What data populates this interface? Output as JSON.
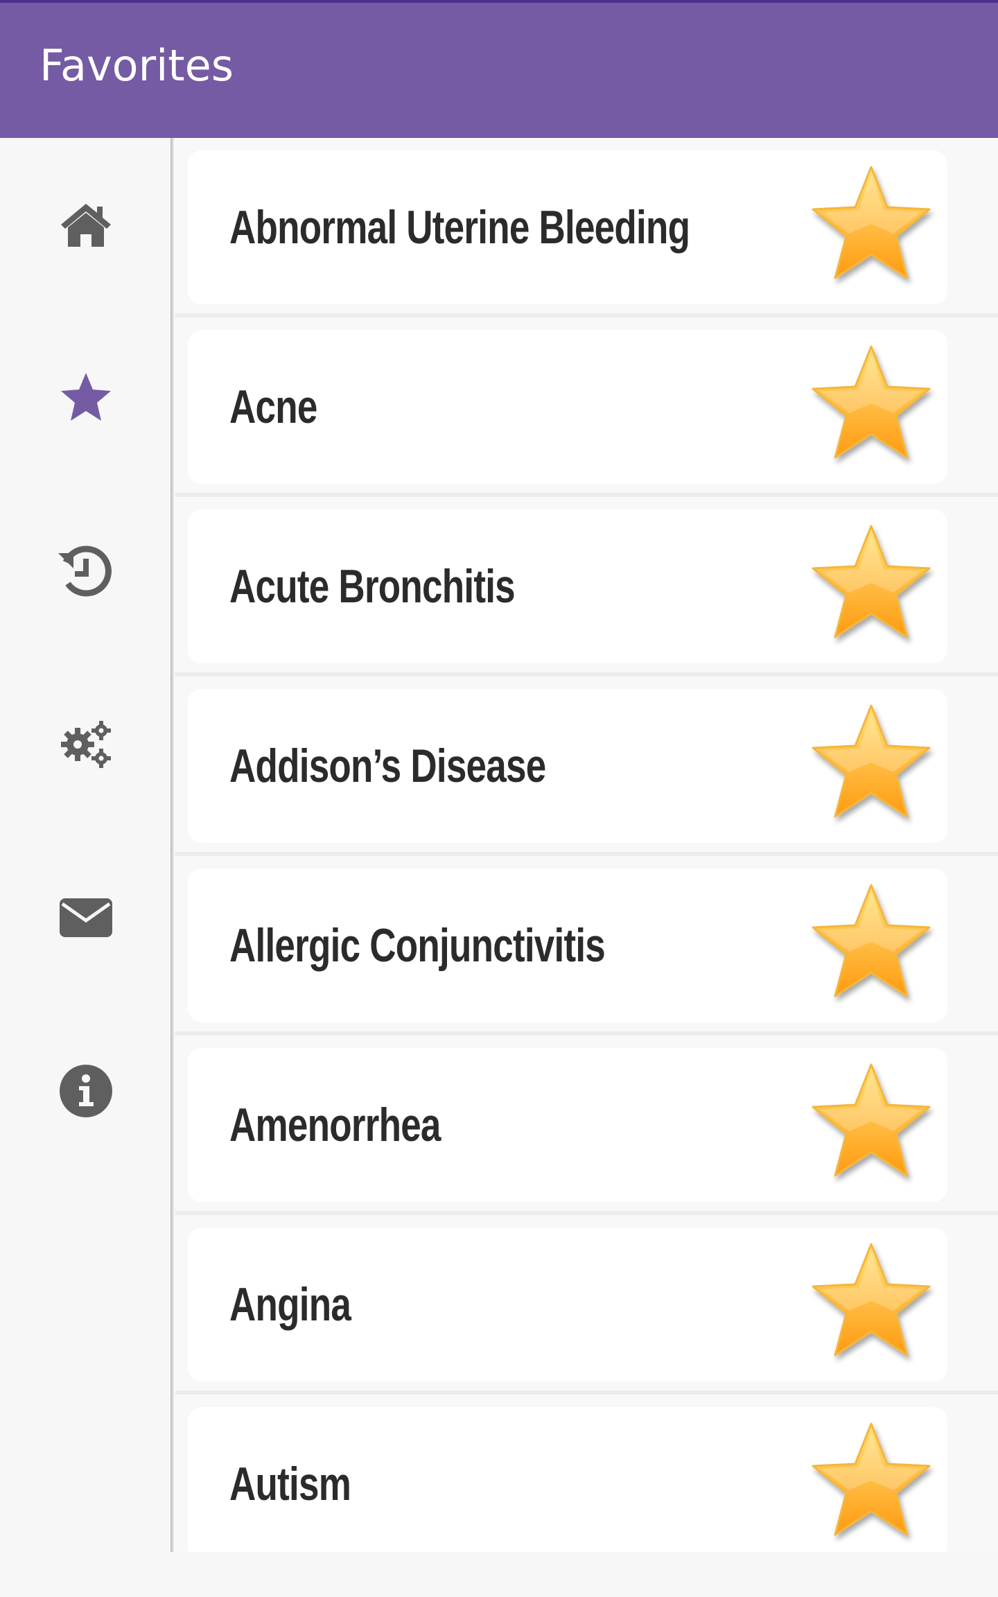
{
  "appbar": {
    "title": "Favorites"
  },
  "sidebar": {
    "items": [
      {
        "name": "home",
        "icon": "home-icon",
        "color": "#5f5f5f"
      },
      {
        "name": "favorites",
        "icon": "star-icon",
        "color": "#745ba3",
        "active": true
      },
      {
        "name": "history",
        "icon": "history-icon",
        "color": "#5f5f5f"
      },
      {
        "name": "settings",
        "icon": "gears-icon",
        "color": "#5f5f5f"
      },
      {
        "name": "contact",
        "icon": "envelope-icon",
        "color": "#5f5f5f"
      },
      {
        "name": "about",
        "icon": "info-icon",
        "color": "#5f5f5f"
      }
    ]
  },
  "favorites": {
    "items": [
      {
        "label": "Abnormal Uterine Bleeding",
        "favorite": true
      },
      {
        "label": "Acne",
        "favorite": true
      },
      {
        "label": "Acute Bronchitis",
        "favorite": true
      },
      {
        "label": "Addison’s Disease",
        "favorite": true
      },
      {
        "label": "Allergic Conjunctivitis",
        "favorite": true
      },
      {
        "label": "Amenorrhea",
        "favorite": true
      },
      {
        "label": "Angina",
        "favorite": true
      },
      {
        "label": "Autism",
        "favorite": true
      }
    ]
  },
  "colors": {
    "appbar": "#745ba3",
    "appbar_border": "#4b2f93",
    "accent": "#745ba3",
    "icon_gray": "#5f5f5f",
    "star_fill_top": "#ffe27a",
    "star_fill_bottom": "#ff9a10"
  }
}
